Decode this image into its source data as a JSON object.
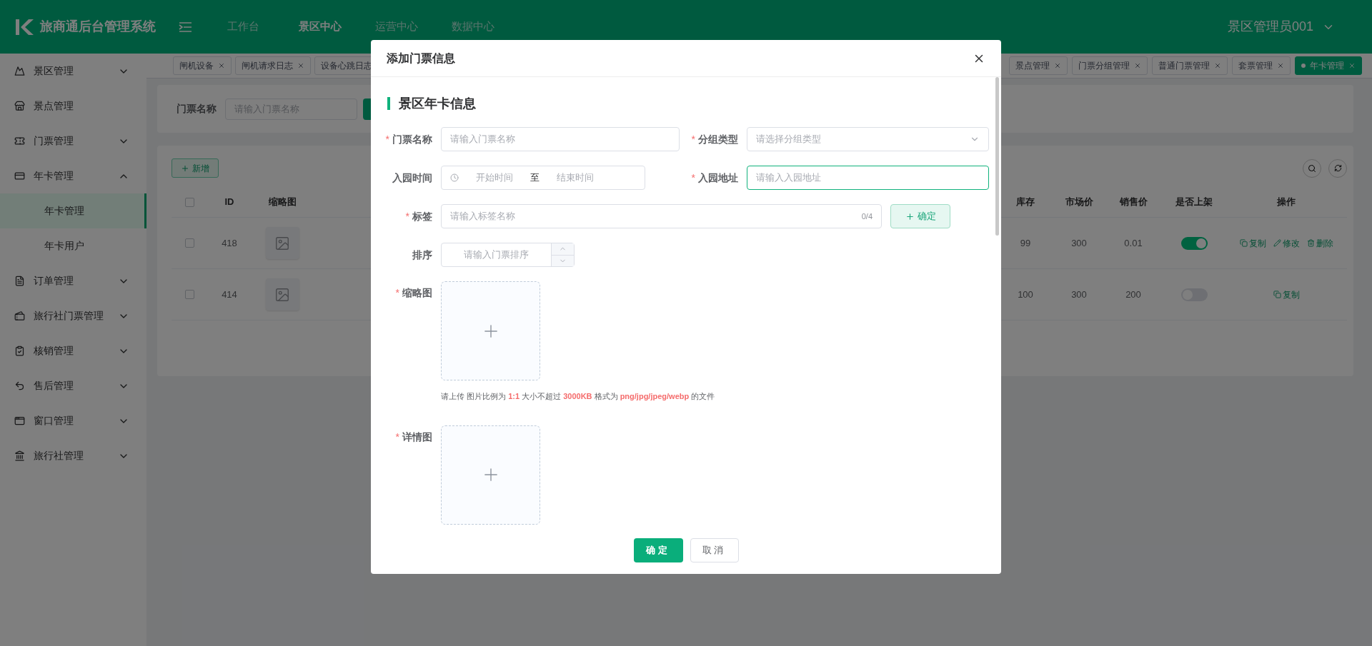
{
  "header": {
    "title": "旅商通后台管理系统",
    "nav": [
      {
        "label": "工作台",
        "selected": false
      },
      {
        "label": "景区中心",
        "selected": true
      },
      {
        "label": "运营中心",
        "selected": false
      },
      {
        "label": "数据中心",
        "selected": false
      }
    ],
    "user": "景区管理员001"
  },
  "sidebar": {
    "items": [
      {
        "label": "景区管理",
        "expanded": false
      },
      {
        "label": "景点管理"
      },
      {
        "label": "门票管理",
        "expanded": false
      },
      {
        "label": "年卡管理",
        "expanded": true,
        "children": [
          {
            "label": "年卡管理",
            "selected": true
          },
          {
            "label": "年卡用户",
            "selected": false
          }
        ]
      },
      {
        "label": "订单管理",
        "expanded": false
      },
      {
        "label": "旅行社门票管理",
        "expanded": false
      },
      {
        "label": "核销管理",
        "expanded": false
      },
      {
        "label": "售后管理",
        "expanded": false
      },
      {
        "label": "窗口管理",
        "expanded": false
      },
      {
        "label": "旅行社管理",
        "expanded": false
      }
    ]
  },
  "tabs": {
    "left": [
      {
        "label": "闸机设备",
        "selected": false,
        "closable": true
      },
      {
        "label": "闸机请求日志",
        "selected": false,
        "closable": true
      },
      {
        "label": "设备心跳日志",
        "selected": false,
        "closable": false
      }
    ],
    "right": [
      {
        "label": "景点管理",
        "selected": false,
        "closable": true
      },
      {
        "label": "门票分组管理",
        "selected": false,
        "closable": true
      },
      {
        "label": "普通门票管理",
        "selected": false,
        "closable": true
      },
      {
        "label": "套票管理",
        "selected": false,
        "closable": true
      },
      {
        "label": "年卡管理",
        "selected": true,
        "closable": true
      }
    ]
  },
  "search": {
    "label": "门票名称",
    "placeholder": "请输入门票名称"
  },
  "table": {
    "add_button": "新增",
    "header_checked": false,
    "columns_left": [
      "ID",
      "缩略图"
    ],
    "columns_right": [
      "库存",
      "市场价",
      "销售价",
      "是否上架",
      "操作"
    ],
    "rows": [
      {
        "checked": false,
        "id": "418",
        "stock": "99",
        "market_price": "300",
        "sale_price": "0.01",
        "on": true,
        "actions": [
          {
            "kind": "copy",
            "label": "复制"
          },
          {
            "kind": "edit",
            "label": "修改"
          },
          {
            "kind": "delete",
            "label": "删除"
          }
        ]
      },
      {
        "checked": false,
        "id": "414",
        "stock": "100",
        "market_price": "300",
        "sale_price": "200",
        "on": false,
        "actions": [
          {
            "kind": "copy",
            "label": "复制"
          }
        ]
      }
    ]
  },
  "modal": {
    "title": "添加门票信息",
    "section": "景区年卡信息",
    "name_field": {
      "label": "门票名称",
      "required_mark": "*",
      "placeholder": "请输入门票名称",
      "focused": false
    },
    "group_type": {
      "label": "分组类型",
      "required_mark": "*",
      "placeholder": "请选择分组类型",
      "focused": false
    },
    "entry_time": {
      "label": "入园时间",
      "start_placeholder": "开始时间",
      "separator": "至",
      "end_placeholder": "结束时间"
    },
    "entry_address": {
      "label": "入园地址",
      "required_mark": "*",
      "placeholder": "请输入入园地址",
      "focused": true
    },
    "tag": {
      "label": "标签",
      "required_mark": "*",
      "placeholder": "请输入标签名称",
      "counter": "0/4",
      "button": "确定"
    },
    "sort": {
      "label": "排序",
      "placeholder": "请输入门票排序"
    },
    "thumbnail": {
      "label": "缩略图",
      "required_mark": "*",
      "hint": "请上传 图片比例为 **1:1** 大小不超过 **3000KB** 格式为 **png/jpg/jpeg/webp** 的文件"
    },
    "detail": {
      "label": "详情图",
      "required_mark": "*"
    },
    "ok": "确定",
    "cancel": "取消"
  }
}
